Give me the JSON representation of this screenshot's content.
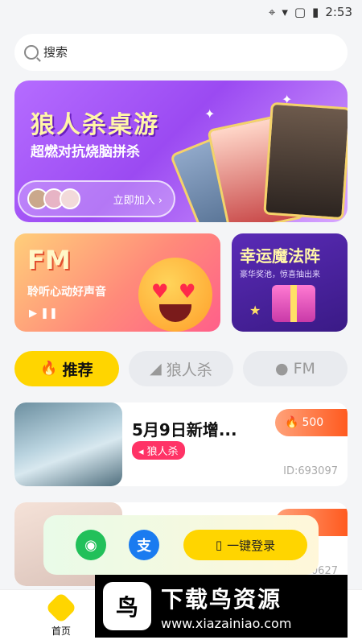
{
  "status": {
    "time": "2:53",
    "icons": [
      "location-icon",
      "wifi-icon",
      "no-sim-icon",
      "battery-icon"
    ]
  },
  "search": {
    "placeholder": "搜索"
  },
  "banner": {
    "title": "狼人杀桌游",
    "subtitle": "超燃对抗烧脑拼杀",
    "join_label": "立即加入 ›"
  },
  "fm_card": {
    "title": "FM",
    "subtitle": "聆听心动好声音"
  },
  "magic_card": {
    "title": "幸运魔法阵",
    "subtitle": "豪华奖池，惊喜抽出来"
  },
  "tabs": [
    {
      "label": "推荐",
      "active": true
    },
    {
      "label": "狼人杀",
      "active": false
    },
    {
      "label": "FM",
      "active": false
    }
  ],
  "rooms": [
    {
      "title": "5月9日新增...",
      "tag": "狼人杀",
      "hot": "500",
      "id": "ID:693097"
    },
    {
      "title": "",
      "tag": "",
      "hot": "",
      "id": "0627"
    }
  ],
  "login_bar": {
    "onekey_label": "一键登录"
  },
  "bottom_nav": {
    "home_label": "首页"
  },
  "watermark": {
    "name": "下载鸟资源",
    "url": "www.xiazainiao.com"
  },
  "colors": {
    "accent": "#ffd500",
    "tag_red": "#ff3366",
    "wechat": "#22c05a",
    "alipay": "#1a7bf0"
  }
}
